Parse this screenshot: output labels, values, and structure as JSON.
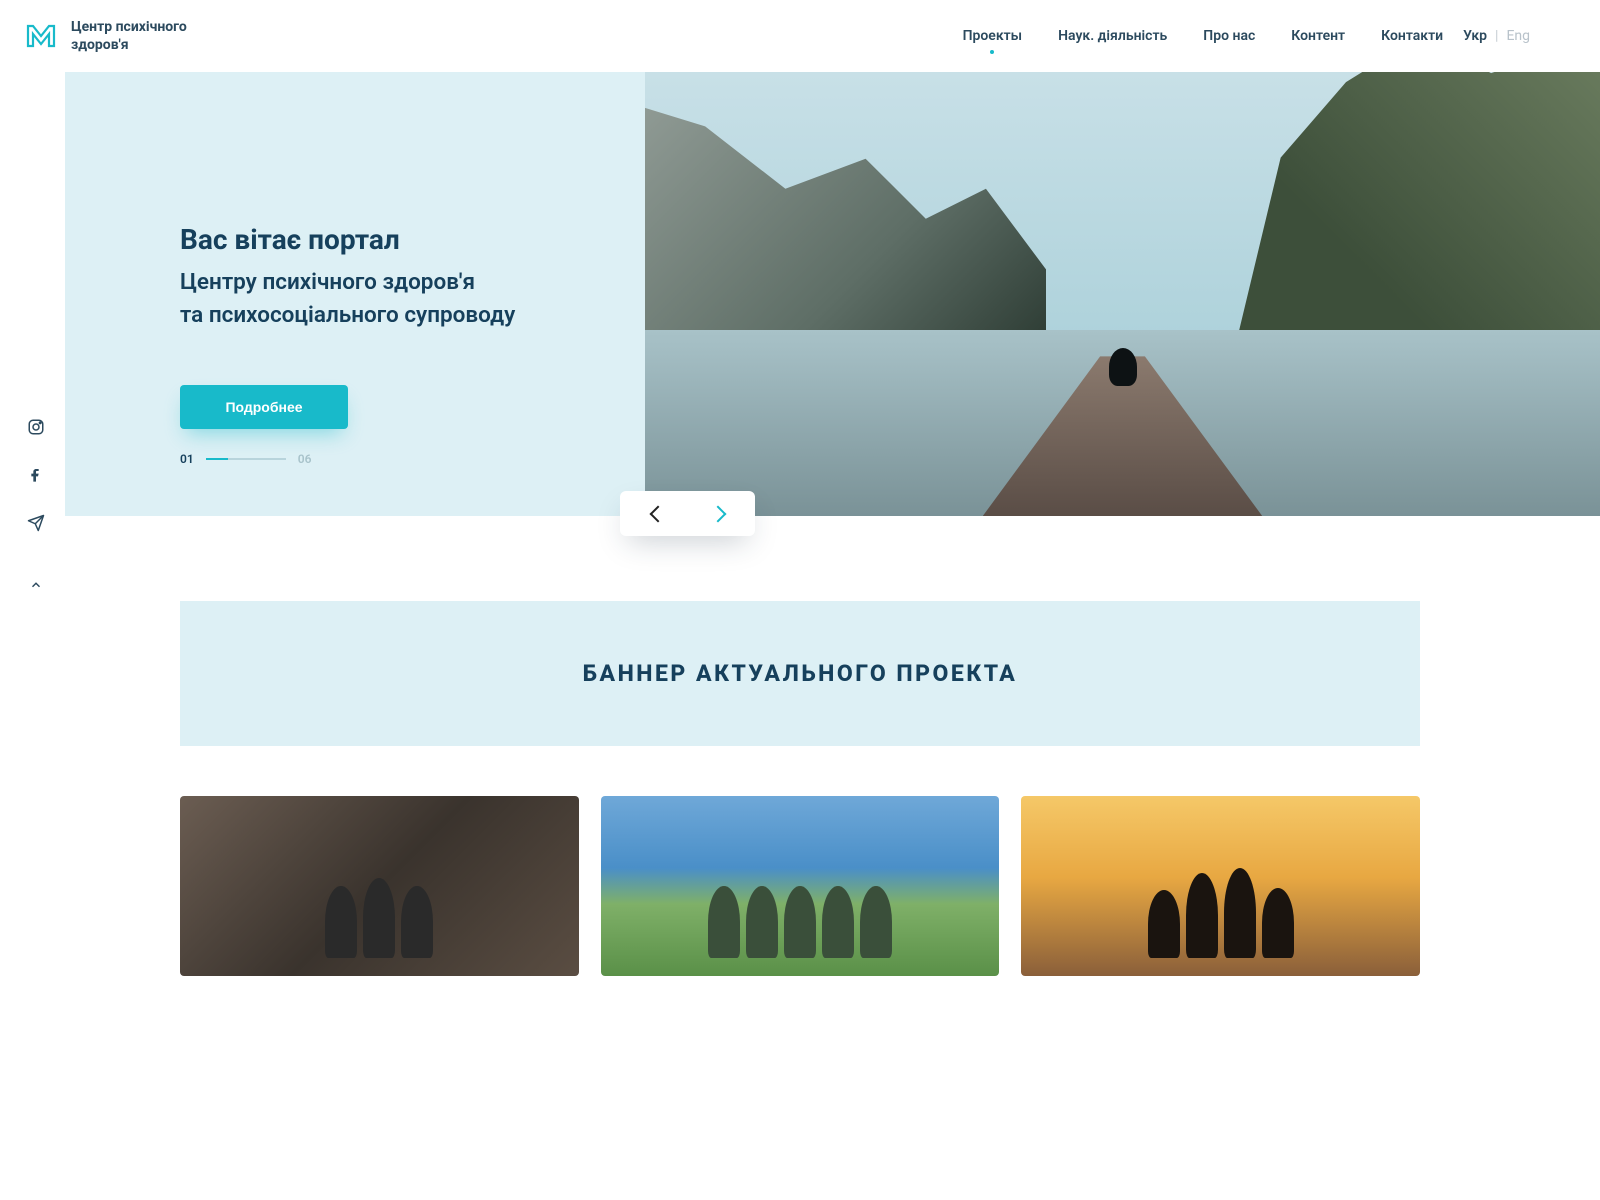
{
  "header": {
    "brand_line1": "Центр психічного",
    "brand_line2": "здоров'я",
    "nav": [
      "Проекты",
      "Наук. діяльність",
      "Про нас",
      "Контент",
      "Контакти"
    ],
    "active_nav_index": 0,
    "lang_active": "Укр",
    "lang_inactive": "Eng"
  },
  "hero": {
    "title": "Вас вітає портал",
    "subtitle_line1": "Центру психічного здоров'я",
    "subtitle_line2": "та психосоціального супроводу",
    "button": "Подробнее",
    "pager_current": "01",
    "pager_total": "06"
  },
  "banner": {
    "title": "БАННЕР АКТУАЛЬНОГО ПРОЕКТА"
  },
  "social": [
    "instagram",
    "facebook",
    "telegram"
  ],
  "colors": {
    "accent": "#18baca",
    "pale": "#ddf0f5",
    "text": "#16405c"
  }
}
